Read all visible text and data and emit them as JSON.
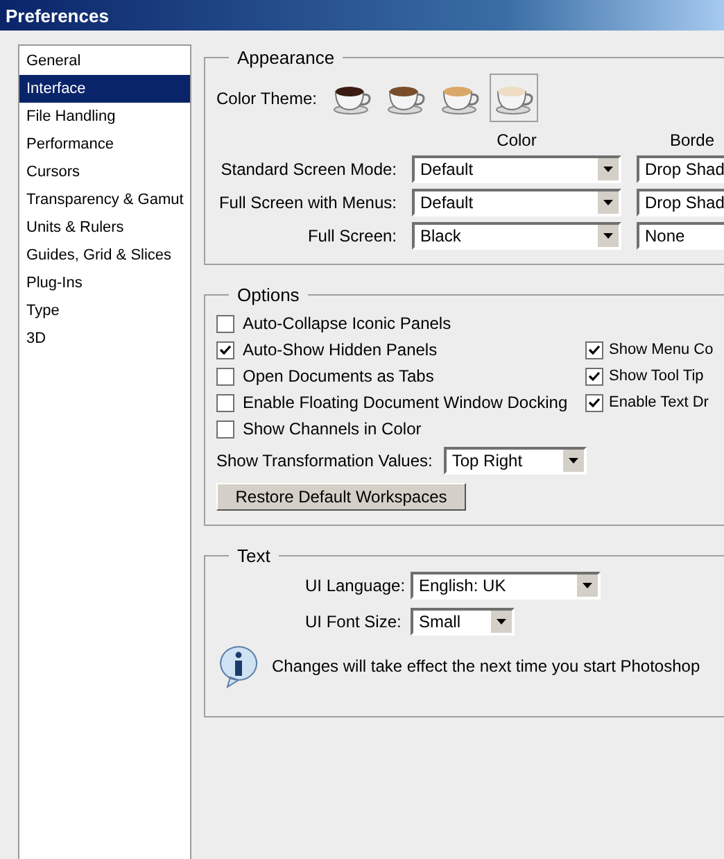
{
  "window": {
    "title": "Preferences"
  },
  "sidebar": {
    "items": [
      {
        "label": "General",
        "selected": false
      },
      {
        "label": "Interface",
        "selected": true
      },
      {
        "label": "File Handling",
        "selected": false
      },
      {
        "label": "Performance",
        "selected": false
      },
      {
        "label": "Cursors",
        "selected": false
      },
      {
        "label": "Transparency & Gamut",
        "selected": false
      },
      {
        "label": "Units & Rulers",
        "selected": false
      },
      {
        "label": "Guides, Grid & Slices",
        "selected": false
      },
      {
        "label": "Plug-Ins",
        "selected": false
      },
      {
        "label": "Type",
        "selected": false
      },
      {
        "label": "3D",
        "selected": false
      }
    ]
  },
  "appearance": {
    "title": "Appearance",
    "color_theme_label": "Color Theme:",
    "themes": [
      {
        "color": "#3b1c12",
        "selected": false
      },
      {
        "color": "#7a4e2a",
        "selected": false
      },
      {
        "color": "#d9a868",
        "selected": false
      },
      {
        "color": "#eedcc4",
        "selected": true
      }
    ],
    "columns": [
      "Color",
      "Borde"
    ],
    "rows": [
      {
        "label": "Standard Screen Mode:",
        "color_value": "Default",
        "border_value": "Drop Shad"
      },
      {
        "label": "Full Screen with Menus:",
        "color_value": "Default",
        "border_value": "Drop Shad"
      },
      {
        "label": "Full Screen:",
        "color_value": "Black",
        "border_value": "None"
      }
    ]
  },
  "options": {
    "title": "Options",
    "left": [
      {
        "label": "Auto-Collapse Iconic Panels",
        "checked": false
      },
      {
        "label": "Auto-Show Hidden Panels",
        "checked": true
      },
      {
        "label": "Open Documents as Tabs",
        "checked": false
      },
      {
        "label": "Enable Floating Document Window Docking",
        "checked": false
      },
      {
        "label": "Show Channels in Color",
        "checked": false
      }
    ],
    "right": [
      {
        "label": "Show Menu Co",
        "checked": true
      },
      {
        "label": "Show Tool Tip",
        "checked": true
      },
      {
        "label": "Enable Text Dr",
        "checked": true
      }
    ],
    "transformation": {
      "label": "Show Transformation Values:",
      "value": "Top Right"
    },
    "button": "Restore Default Workspaces"
  },
  "text": {
    "title": "Text",
    "language": {
      "label": "UI Language:",
      "value": "English: UK"
    },
    "font_size": {
      "label": "UI Font Size:",
      "value": "Small"
    },
    "note": "Changes will take effect the next time you start Photoshop"
  }
}
